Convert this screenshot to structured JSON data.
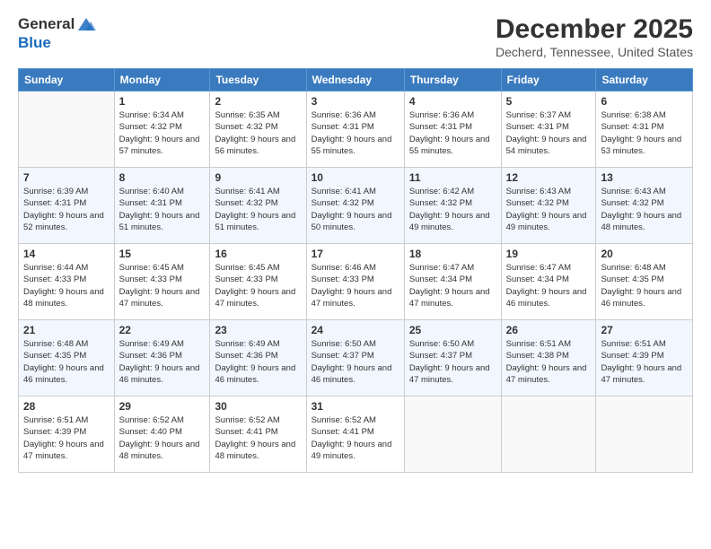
{
  "header": {
    "logo_line1": "General",
    "logo_line2": "Blue",
    "title": "December 2025",
    "subtitle": "Decherd, Tennessee, United States"
  },
  "days_of_week": [
    "Sunday",
    "Monday",
    "Tuesday",
    "Wednesday",
    "Thursday",
    "Friday",
    "Saturday"
  ],
  "weeks": [
    [
      {
        "day": "",
        "sunrise": "",
        "sunset": "",
        "daylight": "",
        "empty": true
      },
      {
        "day": "1",
        "sunrise": "Sunrise: 6:34 AM",
        "sunset": "Sunset: 4:32 PM",
        "daylight": "Daylight: 9 hours and 57 minutes."
      },
      {
        "day": "2",
        "sunrise": "Sunrise: 6:35 AM",
        "sunset": "Sunset: 4:32 PM",
        "daylight": "Daylight: 9 hours and 56 minutes."
      },
      {
        "day": "3",
        "sunrise": "Sunrise: 6:36 AM",
        "sunset": "Sunset: 4:31 PM",
        "daylight": "Daylight: 9 hours and 55 minutes."
      },
      {
        "day": "4",
        "sunrise": "Sunrise: 6:36 AM",
        "sunset": "Sunset: 4:31 PM",
        "daylight": "Daylight: 9 hours and 55 minutes."
      },
      {
        "day": "5",
        "sunrise": "Sunrise: 6:37 AM",
        "sunset": "Sunset: 4:31 PM",
        "daylight": "Daylight: 9 hours and 54 minutes."
      },
      {
        "day": "6",
        "sunrise": "Sunrise: 6:38 AM",
        "sunset": "Sunset: 4:31 PM",
        "daylight": "Daylight: 9 hours and 53 minutes."
      }
    ],
    [
      {
        "day": "7",
        "sunrise": "Sunrise: 6:39 AM",
        "sunset": "Sunset: 4:31 PM",
        "daylight": "Daylight: 9 hours and 52 minutes."
      },
      {
        "day": "8",
        "sunrise": "Sunrise: 6:40 AM",
        "sunset": "Sunset: 4:31 PM",
        "daylight": "Daylight: 9 hours and 51 minutes."
      },
      {
        "day": "9",
        "sunrise": "Sunrise: 6:41 AM",
        "sunset": "Sunset: 4:32 PM",
        "daylight": "Daylight: 9 hours and 51 minutes."
      },
      {
        "day": "10",
        "sunrise": "Sunrise: 6:41 AM",
        "sunset": "Sunset: 4:32 PM",
        "daylight": "Daylight: 9 hours and 50 minutes."
      },
      {
        "day": "11",
        "sunrise": "Sunrise: 6:42 AM",
        "sunset": "Sunset: 4:32 PM",
        "daylight": "Daylight: 9 hours and 49 minutes."
      },
      {
        "day": "12",
        "sunrise": "Sunrise: 6:43 AM",
        "sunset": "Sunset: 4:32 PM",
        "daylight": "Daylight: 9 hours and 49 minutes."
      },
      {
        "day": "13",
        "sunrise": "Sunrise: 6:43 AM",
        "sunset": "Sunset: 4:32 PM",
        "daylight": "Daylight: 9 hours and 48 minutes."
      }
    ],
    [
      {
        "day": "14",
        "sunrise": "Sunrise: 6:44 AM",
        "sunset": "Sunset: 4:33 PM",
        "daylight": "Daylight: 9 hours and 48 minutes."
      },
      {
        "day": "15",
        "sunrise": "Sunrise: 6:45 AM",
        "sunset": "Sunset: 4:33 PM",
        "daylight": "Daylight: 9 hours and 47 minutes."
      },
      {
        "day": "16",
        "sunrise": "Sunrise: 6:45 AM",
        "sunset": "Sunset: 4:33 PM",
        "daylight": "Daylight: 9 hours and 47 minutes."
      },
      {
        "day": "17",
        "sunrise": "Sunrise: 6:46 AM",
        "sunset": "Sunset: 4:33 PM",
        "daylight": "Daylight: 9 hours and 47 minutes."
      },
      {
        "day": "18",
        "sunrise": "Sunrise: 6:47 AM",
        "sunset": "Sunset: 4:34 PM",
        "daylight": "Daylight: 9 hours and 47 minutes."
      },
      {
        "day": "19",
        "sunrise": "Sunrise: 6:47 AM",
        "sunset": "Sunset: 4:34 PM",
        "daylight": "Daylight: 9 hours and 46 minutes."
      },
      {
        "day": "20",
        "sunrise": "Sunrise: 6:48 AM",
        "sunset": "Sunset: 4:35 PM",
        "daylight": "Daylight: 9 hours and 46 minutes."
      }
    ],
    [
      {
        "day": "21",
        "sunrise": "Sunrise: 6:48 AM",
        "sunset": "Sunset: 4:35 PM",
        "daylight": "Daylight: 9 hours and 46 minutes."
      },
      {
        "day": "22",
        "sunrise": "Sunrise: 6:49 AM",
        "sunset": "Sunset: 4:36 PM",
        "daylight": "Daylight: 9 hours and 46 minutes."
      },
      {
        "day": "23",
        "sunrise": "Sunrise: 6:49 AM",
        "sunset": "Sunset: 4:36 PM",
        "daylight": "Daylight: 9 hours and 46 minutes."
      },
      {
        "day": "24",
        "sunrise": "Sunrise: 6:50 AM",
        "sunset": "Sunset: 4:37 PM",
        "daylight": "Daylight: 9 hours and 46 minutes."
      },
      {
        "day": "25",
        "sunrise": "Sunrise: 6:50 AM",
        "sunset": "Sunset: 4:37 PM",
        "daylight": "Daylight: 9 hours and 47 minutes."
      },
      {
        "day": "26",
        "sunrise": "Sunrise: 6:51 AM",
        "sunset": "Sunset: 4:38 PM",
        "daylight": "Daylight: 9 hours and 47 minutes."
      },
      {
        "day": "27",
        "sunrise": "Sunrise: 6:51 AM",
        "sunset": "Sunset: 4:39 PM",
        "daylight": "Daylight: 9 hours and 47 minutes."
      }
    ],
    [
      {
        "day": "28",
        "sunrise": "Sunrise: 6:51 AM",
        "sunset": "Sunset: 4:39 PM",
        "daylight": "Daylight: 9 hours and 47 minutes."
      },
      {
        "day": "29",
        "sunrise": "Sunrise: 6:52 AM",
        "sunset": "Sunset: 4:40 PM",
        "daylight": "Daylight: 9 hours and 48 minutes."
      },
      {
        "day": "30",
        "sunrise": "Sunrise: 6:52 AM",
        "sunset": "Sunset: 4:41 PM",
        "daylight": "Daylight: 9 hours and 48 minutes."
      },
      {
        "day": "31",
        "sunrise": "Sunrise: 6:52 AM",
        "sunset": "Sunset: 4:41 PM",
        "daylight": "Daylight: 9 hours and 49 minutes."
      },
      {
        "day": "",
        "sunrise": "",
        "sunset": "",
        "daylight": "",
        "empty": true
      },
      {
        "day": "",
        "sunrise": "",
        "sunset": "",
        "daylight": "",
        "empty": true
      },
      {
        "day": "",
        "sunrise": "",
        "sunset": "",
        "daylight": "",
        "empty": true
      }
    ]
  ]
}
